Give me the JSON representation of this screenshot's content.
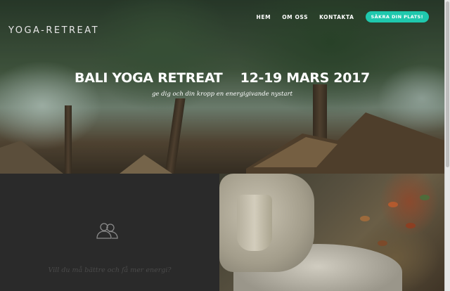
{
  "header": {
    "logo": "YOGA-RETREAT",
    "nav": [
      {
        "label": "HEM"
      },
      {
        "label": "OM OSS"
      },
      {
        "label": "KONTAKTA"
      }
    ],
    "cta_label": "SÄKRA DIN PLATS!"
  },
  "hero": {
    "title": "BALI YOGA RETREAT    12-19 MARS 2017",
    "subtitle": "ge dig och din kropp en energigivande nystart"
  },
  "feature": {
    "icon": "users-icon",
    "text": "Vill du må bättre och få mer energi?"
  },
  "colors": {
    "accent": "#1fc8ad",
    "panel_dark": "#2a2a2a"
  }
}
